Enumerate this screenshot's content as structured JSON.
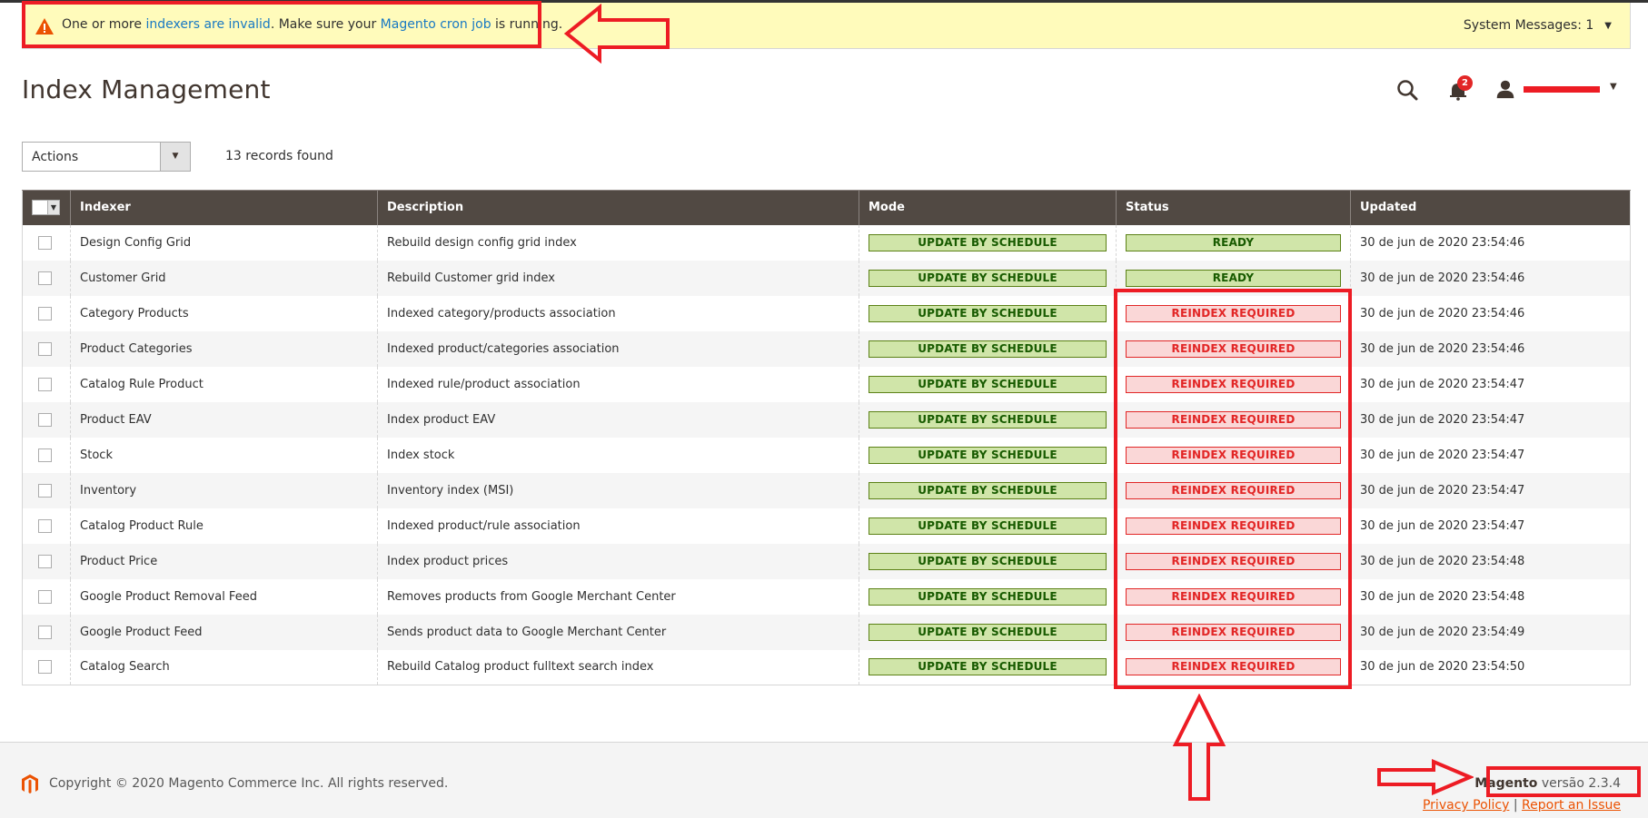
{
  "system_message": {
    "icon": "warning-triangle-icon",
    "text_before": "One or more ",
    "link1": "indexers are invalid",
    "text_middle": ". Make sure your ",
    "link2": "Magento cron job",
    "text_after": " is running.",
    "count_label": "System Messages: 1"
  },
  "header": {
    "title": "Index Management",
    "notifications_count": "2",
    "search_icon": "search-icon",
    "bell_icon": "bell-icon",
    "user_icon": "user-icon"
  },
  "toolbar": {
    "actions_label": "Actions",
    "records_found": "13 records found"
  },
  "table": {
    "columns": [
      "Indexer",
      "Description",
      "Mode",
      "Status",
      "Updated"
    ],
    "rows": [
      {
        "indexer": "Design Config Grid",
        "description": "Rebuild design config grid index",
        "mode": "UPDATE BY SCHEDULE",
        "status": "READY",
        "updated": "30 de jun de 2020 23:54:46"
      },
      {
        "indexer": "Customer Grid",
        "description": "Rebuild Customer grid index",
        "mode": "UPDATE BY SCHEDULE",
        "status": "READY",
        "updated": "30 de jun de 2020 23:54:46"
      },
      {
        "indexer": "Category Products",
        "description": "Indexed category/products association",
        "mode": "UPDATE BY SCHEDULE",
        "status": "REINDEX REQUIRED",
        "updated": "30 de jun de 2020 23:54:46"
      },
      {
        "indexer": "Product Categories",
        "description": "Indexed product/categories association",
        "mode": "UPDATE BY SCHEDULE",
        "status": "REINDEX REQUIRED",
        "updated": "30 de jun de 2020 23:54:46"
      },
      {
        "indexer": "Catalog Rule Product",
        "description": "Indexed rule/product association",
        "mode": "UPDATE BY SCHEDULE",
        "status": "REINDEX REQUIRED",
        "updated": "30 de jun de 2020 23:54:47"
      },
      {
        "indexer": "Product EAV",
        "description": "Index product EAV",
        "mode": "UPDATE BY SCHEDULE",
        "status": "REINDEX REQUIRED",
        "updated": "30 de jun de 2020 23:54:47"
      },
      {
        "indexer": "Stock",
        "description": "Index stock",
        "mode": "UPDATE BY SCHEDULE",
        "status": "REINDEX REQUIRED",
        "updated": "30 de jun de 2020 23:54:47"
      },
      {
        "indexer": "Inventory",
        "description": "Inventory index (MSI)",
        "mode": "UPDATE BY SCHEDULE",
        "status": "REINDEX REQUIRED",
        "updated": "30 de jun de 2020 23:54:47"
      },
      {
        "indexer": "Catalog Product Rule",
        "description": "Indexed product/rule association",
        "mode": "UPDATE BY SCHEDULE",
        "status": "REINDEX REQUIRED",
        "updated": "30 de jun de 2020 23:54:47"
      },
      {
        "indexer": "Product Price",
        "description": "Index product prices",
        "mode": "UPDATE BY SCHEDULE",
        "status": "REINDEX REQUIRED",
        "updated": "30 de jun de 2020 23:54:48"
      },
      {
        "indexer": "Google Product Removal Feed",
        "description": "Removes products from Google Merchant Center",
        "mode": "UPDATE BY SCHEDULE",
        "status": "REINDEX REQUIRED",
        "updated": "30 de jun de 2020 23:54:48"
      },
      {
        "indexer": "Google Product Feed",
        "description": "Sends product data to Google Merchant Center",
        "mode": "UPDATE BY SCHEDULE",
        "status": "REINDEX REQUIRED",
        "updated": "30 de jun de 2020 23:54:49"
      },
      {
        "indexer": "Catalog Search",
        "description": "Rebuild Catalog product fulltext search index",
        "mode": "UPDATE BY SCHEDULE",
        "status": "REINDEX REQUIRED",
        "updated": "30 de jun de 2020 23:54:50"
      }
    ]
  },
  "footer": {
    "copyright": "Copyright © 2020 Magento Commerce Inc. All rights reserved.",
    "brand": "Magento",
    "version": " versão 2.3.4",
    "privacy_link": "Privacy Policy",
    "separator": " | ",
    "report_link": "Report an Issue"
  },
  "colors": {
    "accent_link": "#1979c3",
    "status_ok": "#185b00",
    "status_error": "#e22626",
    "annotation": "#ed1c24",
    "grid_header": "#514943",
    "footer_link": "#eb5202"
  }
}
